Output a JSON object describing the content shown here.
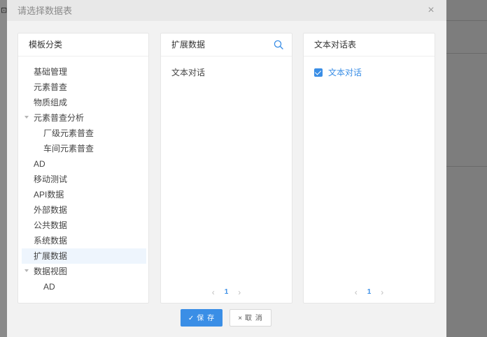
{
  "background": {
    "glyph": "⊡"
  },
  "dialog": {
    "title": "请选择数据表",
    "close_icon": "×"
  },
  "template_panel": {
    "header": "模板分类",
    "items": [
      {
        "label": "基础管理"
      },
      {
        "label": "元素普查"
      },
      {
        "label": "物质组成"
      },
      {
        "label": "元素普查分析",
        "expanded": true
      },
      {
        "label": "厂级元素普查"
      },
      {
        "label": "车间元素普查"
      },
      {
        "label": "AD"
      },
      {
        "label": "移动测试"
      },
      {
        "label": "API数据"
      },
      {
        "label": "外部数据"
      },
      {
        "label": "公共数据"
      },
      {
        "label": "系统数据"
      },
      {
        "label": "扩展数据",
        "selected": true
      },
      {
        "label": "数据视图",
        "expanded": true
      },
      {
        "label": "AD"
      }
    ]
  },
  "extension_panel": {
    "header": "扩展数据",
    "items": [
      {
        "label": "文本对话"
      }
    ],
    "pager": {
      "prev": "‹",
      "page": "1",
      "next": "›"
    }
  },
  "dialog_table_panel": {
    "header": "文本对话表",
    "items": [
      {
        "label": "文本对话",
        "checked": true
      }
    ],
    "pager": {
      "prev": "‹",
      "page": "1",
      "next": "›"
    }
  },
  "footer": {
    "save_label": "保 存",
    "save_icon": "✓",
    "cancel_label": "取 消",
    "cancel_icon": "×"
  },
  "colors": {
    "accent": "#3a8ee6",
    "selected_bg": "#eef5fd",
    "overlay": "#7b7b7b"
  }
}
